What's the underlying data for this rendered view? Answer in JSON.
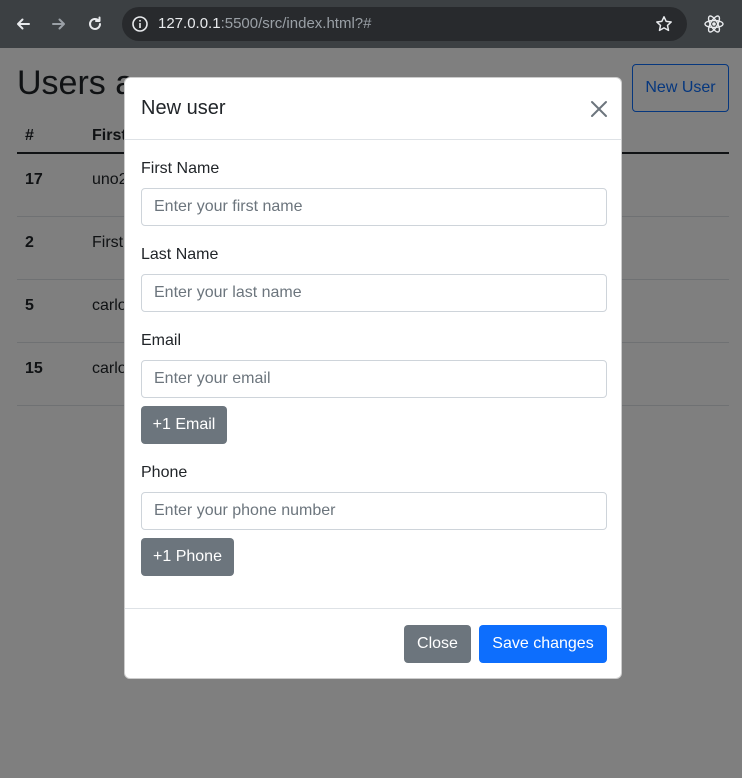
{
  "browser": {
    "url_host": "127.0.0.1",
    "url_rest": ":5500/src/index.html?#",
    "icons": [
      "back-arrow-icon",
      "forward-arrow-icon",
      "reload-icon",
      "site-info-icon",
      "bookmark-star-icon",
      "react-extension-icon"
    ]
  },
  "page": {
    "title": "Users a",
    "new_user_label": "New User",
    "table": {
      "headers": [
        "#",
        "First"
      ],
      "rows": [
        {
          "id": "17",
          "first": "uno2"
        },
        {
          "id": "2",
          "first": "First"
        },
        {
          "id": "5",
          "first": "carlo"
        },
        {
          "id": "15",
          "first": "carlo"
        }
      ]
    }
  },
  "modal": {
    "title": "New user",
    "first_name": {
      "label": "First Name",
      "placeholder": "Enter your first name",
      "value": ""
    },
    "last_name": {
      "label": "Last Name",
      "placeholder": "Enter your last name",
      "value": ""
    },
    "email": {
      "label": "Email",
      "placeholder": "Enter your email",
      "value": "",
      "add_label": "+1 Email"
    },
    "phone": {
      "label": "Phone",
      "placeholder": "Enter your phone number",
      "value": "",
      "add_label": "+1 Phone"
    },
    "close_label": "Close",
    "save_label": "Save changes"
  },
  "colors": {
    "primary": "#0d6efd",
    "secondary": "#6c757d",
    "chrome_bg": "#3c4043"
  }
}
